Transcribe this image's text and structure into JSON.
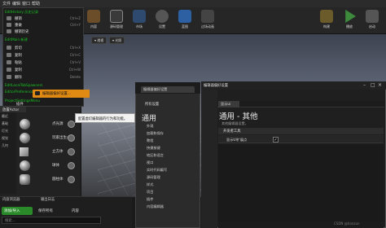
{
  "menubar": {
    "items": [
      "文件",
      "编辑",
      "窗口",
      "帮助"
    ]
  },
  "toolbar": {
    "buttons": [
      {
        "label": "内容"
      },
      {
        "label": "源码管理"
      },
      {
        "label": "市场"
      },
      {
        "label": "设置"
      },
      {
        "label": "蓝图"
      },
      {
        "label": "过场动画"
      },
      {
        "label": "构建"
      },
      {
        "label": "播放"
      },
      {
        "label": "启动"
      }
    ]
  },
  "file_menu": {
    "headers": [
      "EditHistory 历史记录",
      "EditMain 新建"
    ],
    "items": [
      {
        "label": "撤销",
        "shortcut": "Ctrl+Z"
      },
      {
        "label": "重做",
        "shortcut": "Ctrl+Y"
      },
      {
        "label": "撤销历史",
        "shortcut": ""
      },
      {
        "label": "剪切",
        "shortcut": "Ctrl+X"
      },
      {
        "label": "复制",
        "shortcut": "Ctrl+C"
      },
      {
        "label": "粘贴",
        "shortcut": "Ctrl+V"
      },
      {
        "label": "复制",
        "shortcut": "Ctrl+W"
      },
      {
        "label": "删除",
        "shortcut": "Delete"
      }
    ],
    "sections": [
      "EditLocalTabSpawners",
      "EditorPreferencesMenu",
      "ProjectSettingsMenu"
    ],
    "highlighted": "编辑器偏好设置...",
    "footer": "插件"
  },
  "tooltip": "配置虚幻编辑器的行为和功能。",
  "place_panel": {
    "tab": "放置Actor",
    "categories": [
      "最近",
      "基础",
      "灯光",
      "视觉",
      "几何"
    ],
    "shapes": [
      {
        "label": "点光源",
        "kind": "ball"
      },
      {
        "label": "玩家出生点",
        "kind": "ball"
      },
      {
        "label": "立方体",
        "kind": "cube"
      },
      {
        "label": "球体",
        "kind": "ball"
      },
      {
        "label": "圆柱体",
        "kind": "ball"
      }
    ]
  },
  "bottom": {
    "tabs": [
      "内容浏览器",
      "输出日志"
    ],
    "add_button": "添加/导入",
    "save_button": "保存所有",
    "content_label": "内容",
    "search_placeholder": "搜索..."
  },
  "pref_window": {
    "tab_title": "编辑器偏好设置",
    "search_label": "所有设置",
    "heading": "通用",
    "items": [
      "外观",
      "加载和保存",
      "教程",
      "快捷按键",
      "地区和语言",
      "视口",
      "实时代码编写",
      "源码管理",
      "样式",
      "项目",
      "插件",
      "内容编辑器"
    ]
  },
  "details": {
    "title": "编辑器偏好设置",
    "tab": "显示ui",
    "heading": "通用 - 其他",
    "subtitle": "其他编辑器设置。",
    "section": "开发者工具",
    "row_label": "显示UI扩展点",
    "row_checked": "✓",
    "watermark": "CSDN @tianzun"
  }
}
